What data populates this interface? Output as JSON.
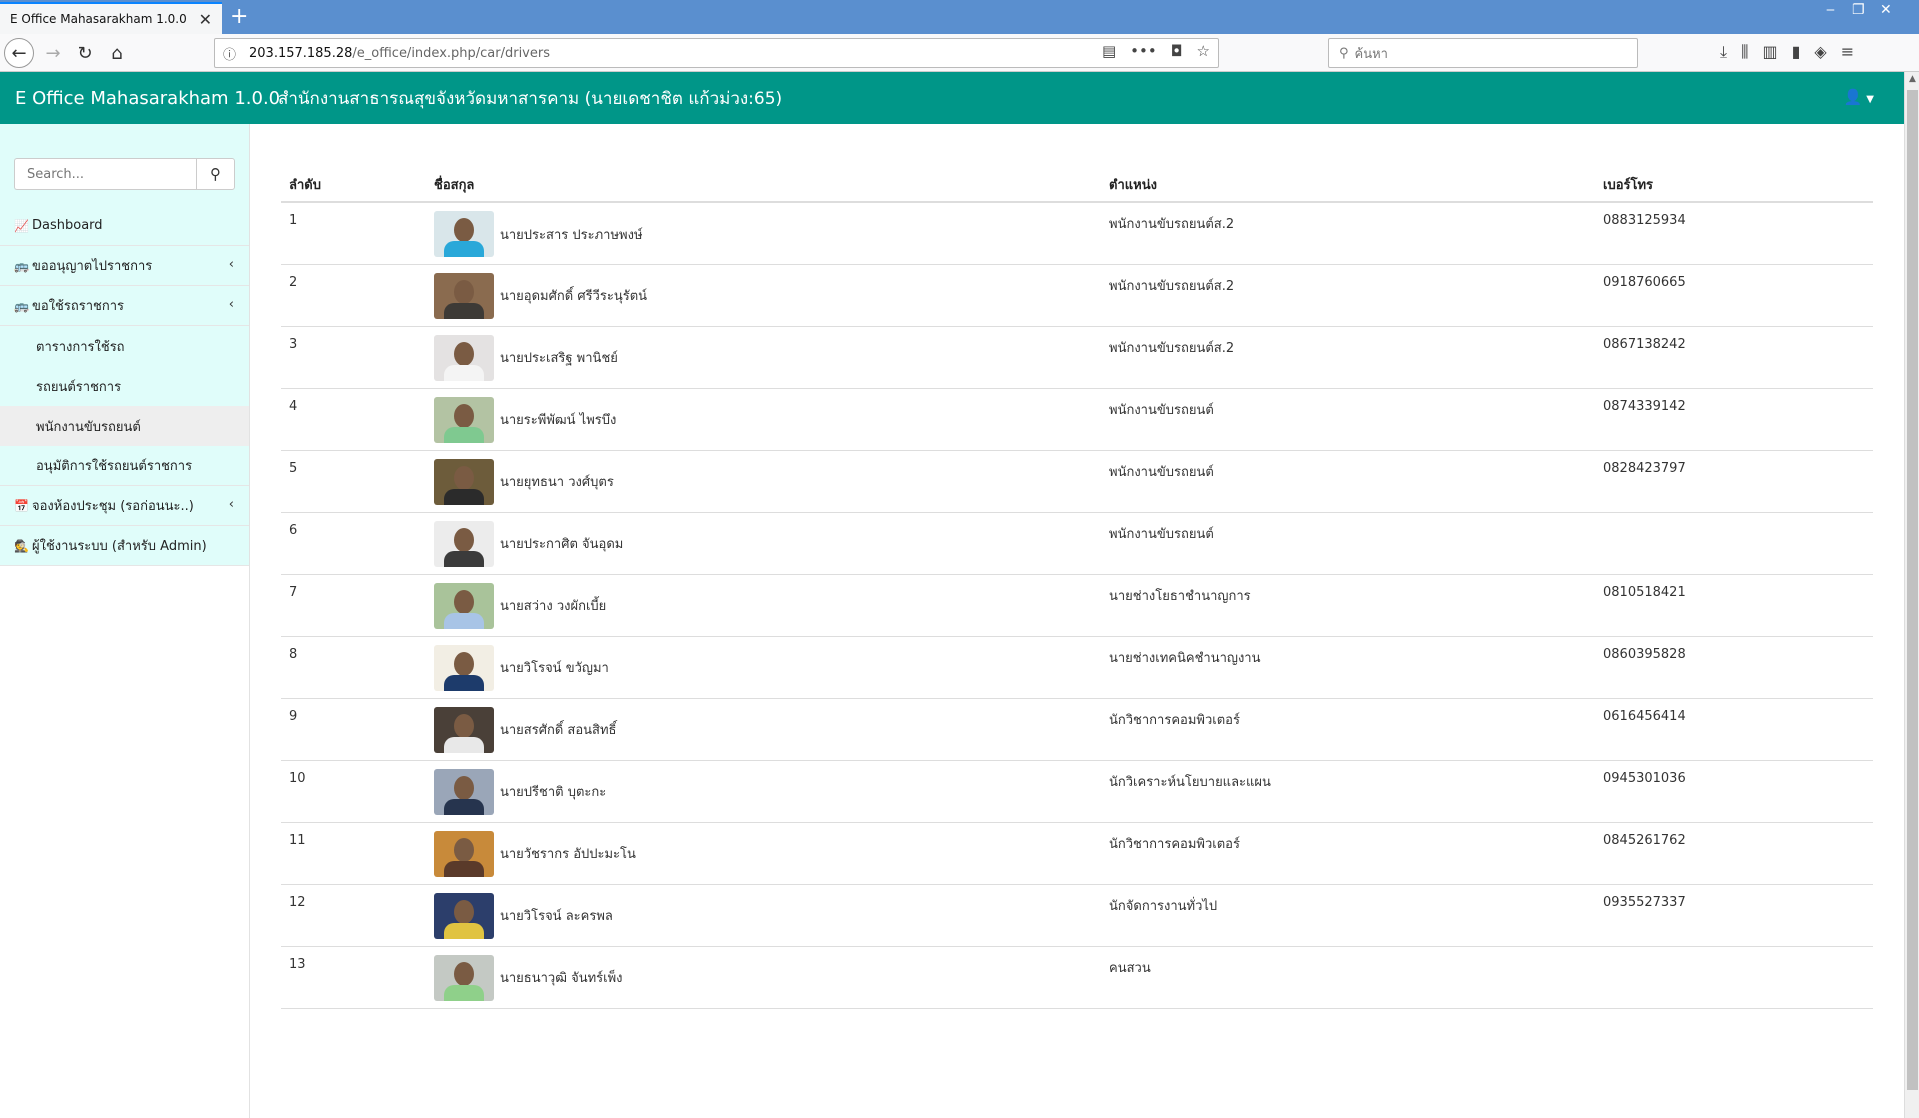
{
  "browser": {
    "tab_title": "E Office Mahasarakham 1.0.0",
    "url_host": "203.157.185.28",
    "url_path": "/e_office/index.php/car/drivers",
    "search_placeholder": "ค้นหา"
  },
  "header": {
    "brand": "E Office Mahasarakham 1.0.0",
    "org_title": "สำนักงานสาธารณสุขจังหวัดมหาสารคาม (นายเดชาชิต แก้วม่วง:65)"
  },
  "sidebar": {
    "search_placeholder": "Search...",
    "items": [
      {
        "label": "Dashboard"
      },
      {
        "label": "ขออนุญาตไปราชการ"
      },
      {
        "label": "ขอใช้รถราชการ"
      },
      {
        "label": "จองห้องประชุม (รอก่อนนะ..)"
      },
      {
        "label": "ผู้ใช้งานระบบ (สำหรับ Admin)"
      }
    ],
    "sub_items": [
      {
        "label": "ตารางการใช้รถ"
      },
      {
        "label": "รถยนต์ราชการ"
      },
      {
        "label": "พนักงานขับรถยนต์"
      },
      {
        "label": "อนุมัติการใช้รถยนต์ราชการ"
      }
    ]
  },
  "table": {
    "headers": [
      "ลำดับ",
      "ชื่อสกุล",
      "ตำแหน่ง",
      "เบอร์โทร"
    ],
    "rows": [
      {
        "no": "1",
        "name": "นายประสาร ประภาษพงษ์",
        "position": "พนักงานขับรถยนต์ส.2",
        "phone": "0883125934",
        "photo_bg": "#d9e6ea",
        "photo_shirt": "#29a8d9"
      },
      {
        "no": "2",
        "name": "นายอุดมศักดิ์ ศรีวีระนุรัตน์",
        "position": "พนักงานขับรถยนต์ส.2",
        "phone": "0918760665",
        "photo_bg": "#8a6b4f",
        "photo_shirt": "#3d3a36"
      },
      {
        "no": "3",
        "name": "นายประเสริฐ พานิชย์",
        "position": "พนักงานขับรถยนต์ส.2",
        "phone": "0867138242",
        "photo_bg": "#e4e2e2",
        "photo_shirt": "#f4f4f4"
      },
      {
        "no": "4",
        "name": "นายระพีพัฒน์ ไพรบึง",
        "position": "พนักงานขับรถยนต์",
        "phone": "0874339142",
        "photo_bg": "#b3c3a3",
        "photo_shirt": "#7fc990"
      },
      {
        "no": "5",
        "name": "นายยุทธนา วงศ์บุตร",
        "position": "พนักงานขับรถยนต์",
        "phone": "0828423797",
        "photo_bg": "#6d5c3b",
        "photo_shirt": "#2b2b2b"
      },
      {
        "no": "6",
        "name": "นายประกาศิต จันอุดม",
        "position": "พนักงานขับรถยนต์",
        "phone": "",
        "photo_bg": "#ececec",
        "photo_shirt": "#3b3b3b"
      },
      {
        "no": "7",
        "name": "นายสว่าง วงผักเบี้ย",
        "position": "นายช่างโยธาชำนาญการ",
        "phone": "0810518421",
        "photo_bg": "#a9c39a",
        "photo_shirt": "#a8c4e6"
      },
      {
        "no": "8",
        "name": "นายวิโรจน์ ขวัญมา",
        "position": "นายช่างเทคนิคชำนาญงาน",
        "phone": "0860395828",
        "photo_bg": "#f2eee4",
        "photo_shirt": "#1d3b6b"
      },
      {
        "no": "9",
        "name": "นายสรศักดิ์ สอนสิทธิ์",
        "position": "นักวิชาการคอมพิวเตอร์",
        "phone": "0616456414",
        "photo_bg": "#4a4038",
        "photo_shirt": "#e8e8e8"
      },
      {
        "no": "10",
        "name": "นายปรีชาติ บุตะกะ",
        "position": "นักวิเคราะห์นโยบายและแผน",
        "phone": "0945301036",
        "photo_bg": "#9aa6b8",
        "photo_shirt": "#26344e"
      },
      {
        "no": "11",
        "name": "นายวัชรากร อัปปะมะโน",
        "position": "นักวิชาการคอมพิวเตอร์",
        "phone": "0845261762",
        "photo_bg": "#c88a3a",
        "photo_shirt": "#5a3a2a"
      },
      {
        "no": "12",
        "name": "นายวิโรจน์ ละครพล",
        "position": "นักจัดการงานทั่วไป",
        "phone": "0935527337",
        "photo_bg": "#2c3e6b",
        "photo_shirt": "#e0c341"
      },
      {
        "no": "13",
        "name": "นายธนาวุฒิ จันทร์เพ็ง",
        "position": "คนสวน",
        "phone": "",
        "photo_bg": "#c4c9c4",
        "photo_shirt": "#8fd08a"
      }
    ]
  },
  "colors": {
    "header_bg": "#009688",
    "sidebar_bg": "#e0fdfa",
    "active_sub_bg": "#eeeeee"
  },
  "icons": {
    "dashboard": "chart-line-icon",
    "bus": "bus-icon",
    "calendar": "calendar-icon",
    "admin": "user-secret-icon",
    "search": "search-icon",
    "user": "user-icon"
  }
}
